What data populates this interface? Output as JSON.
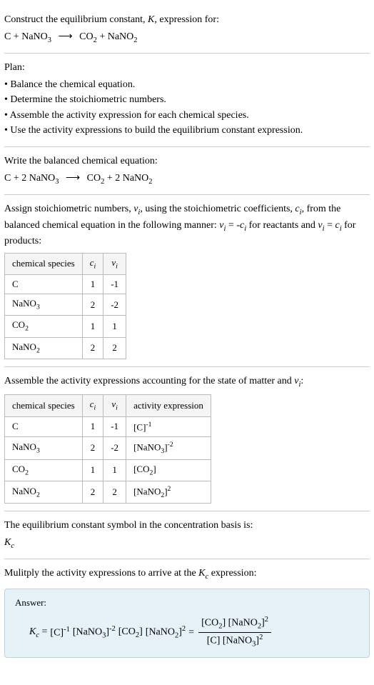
{
  "intro": {
    "line1": "Construct the equilibrium constant, ",
    "k": "K",
    "line1b": ", expression for:",
    "reactants": "C + NaNO",
    "arrow": "⟶",
    "products_co2": "CO",
    "plus": " + ",
    "products_nano2": "NaNO"
  },
  "plan": {
    "heading": "Plan:",
    "items": [
      "• Balance the chemical equation.",
      "• Determine the stoichiometric numbers.",
      "• Assemble the activity expression for each chemical species.",
      "• Use the activity expressions to build the equilibrium constant expression."
    ]
  },
  "balanced": {
    "heading": "Write the balanced chemical equation:",
    "left1": "C + 2 NaNO",
    "arrow": "⟶",
    "right_co2": "CO",
    "plus": " + 2 ",
    "right_nano2": "NaNO"
  },
  "assign": {
    "text1": "Assign stoichiometric numbers, ",
    "nu": "ν",
    "text2": ", using the stoichiometric coefficients, ",
    "c": "c",
    "text3": ", from the balanced chemical equation in the following manner: ",
    "eq_react": " = -",
    "text_react": " for reactants and ",
    "eq_prod": " = ",
    "text_prod": " for products:"
  },
  "table1": {
    "headers": {
      "species": "chemical species",
      "c": "c",
      "nu": "ν"
    },
    "rows": [
      {
        "species": "C",
        "sub": "",
        "c": "1",
        "nu": "-1"
      },
      {
        "species": "NaNO",
        "sub": "3",
        "c": "2",
        "nu": "-2"
      },
      {
        "species": "CO",
        "sub": "2",
        "c": "1",
        "nu": "1"
      },
      {
        "species": "NaNO",
        "sub": "2",
        "c": "2",
        "nu": "2"
      }
    ]
  },
  "assemble": {
    "text": "Assemble the activity expressions accounting for the state of matter and ",
    "nu": "ν",
    "colon": ":"
  },
  "table2": {
    "headers": {
      "species": "chemical species",
      "c": "c",
      "nu": "ν",
      "activity": "activity expression"
    },
    "rows": [
      {
        "species": "C",
        "sub": "",
        "c": "1",
        "nu": "-1",
        "act_base": "[C]",
        "act_sub": "",
        "act_sup": "-1"
      },
      {
        "species": "NaNO",
        "sub": "3",
        "c": "2",
        "nu": "-2",
        "act_base": "[NaNO",
        "act_sub": "3",
        "act_close": "]",
        "act_sup": "-2"
      },
      {
        "species": "CO",
        "sub": "2",
        "c": "1",
        "nu": "1",
        "act_base": "[CO",
        "act_sub": "2",
        "act_close": "]",
        "act_sup": ""
      },
      {
        "species": "NaNO",
        "sub": "2",
        "c": "2",
        "nu": "2",
        "act_base": "[NaNO",
        "act_sub": "2",
        "act_close": "]",
        "act_sup": "2"
      }
    ]
  },
  "kc_symbol": {
    "text": "The equilibrium constant symbol in the concentration basis is:",
    "k": "K",
    "c": "c"
  },
  "multiply": {
    "text1": "Mulitply the activity expressions to arrive at the ",
    "k": "K",
    "c": "c",
    "text2": " expression:"
  },
  "answer": {
    "label": "Answer:",
    "kc_k": "K",
    "kc_c": "c",
    "eq": " = ",
    "t1": "[C]",
    "t1_sup": "-1",
    "t2": " [NaNO",
    "t2_sub": "3",
    "t2_close": "]",
    "t2_sup": "-2",
    "t3": " [CO",
    "t3_sub": "2",
    "t3_close": "] ",
    "t4": "[NaNO",
    "t4_sub": "2",
    "t4_close": "]",
    "t4_sup": "2",
    "eq2": " = ",
    "num1": "[CO",
    "num1_sub": "2",
    "num1_close": "] [NaNO",
    "num2_sub": "2",
    "num2_close": "]",
    "num2_sup": "2",
    "den1": "[C] [NaNO",
    "den1_sub": "3",
    "den1_close": "]",
    "den1_sup": "2"
  }
}
